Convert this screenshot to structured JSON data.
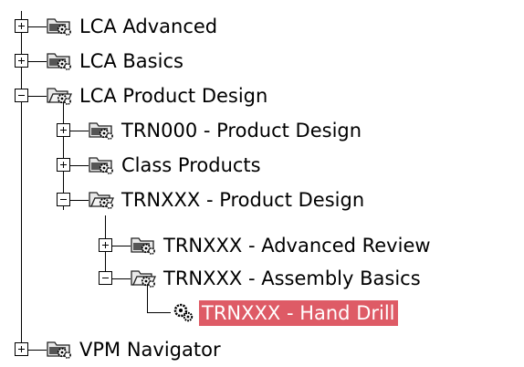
{
  "tree": {
    "items": [
      {
        "label": "LCA Advanced",
        "state": "collapsed",
        "icon": "closed-folder-gears-icon"
      },
      {
        "label": "LCA Basics",
        "state": "collapsed",
        "icon": "closed-folder-gears-icon"
      },
      {
        "label": "LCA Product Design",
        "state": "expanded",
        "icon": "open-folder-gears-icon"
      },
      {
        "label": "TRN000 - Product Design",
        "state": "collapsed",
        "icon": "closed-folder-gears-icon"
      },
      {
        "label": "Class Products",
        "state": "collapsed",
        "icon": "closed-folder-gears-icon"
      },
      {
        "label": "TRNXXX - Product Design",
        "state": "expanded",
        "icon": "open-folder-gears-icon"
      },
      {
        "label": "TRNXXX - Advanced Review",
        "state": "collapsed",
        "icon": "closed-folder-gears-icon"
      },
      {
        "label": "TRNXXX - Assembly Basics",
        "state": "expanded",
        "icon": "open-folder-gears-icon"
      },
      {
        "label": "TRNXXX - Hand Drill",
        "state": "leaf",
        "selected": true,
        "icon": "gears-icon"
      },
      {
        "label": "VPM Navigator",
        "state": "collapsed",
        "icon": "closed-folder-gears-icon"
      }
    ],
    "colors": {
      "selection_background": "#de5b66",
      "selection_text": "#ffffff",
      "text": "#000000",
      "background": "#ffffff"
    }
  }
}
